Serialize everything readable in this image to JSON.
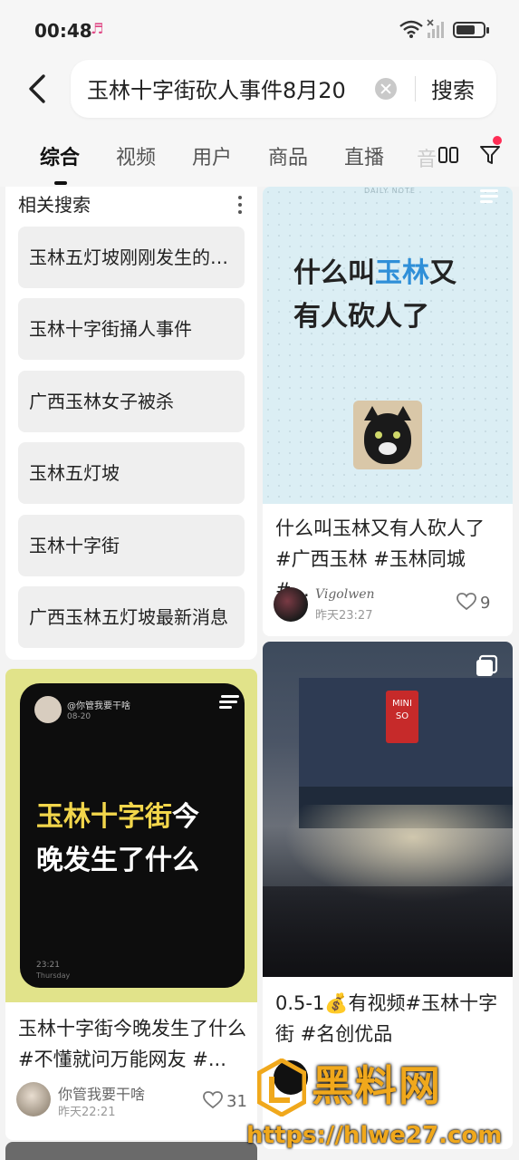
{
  "status_bar": {
    "time": "00:48",
    "music_icon": "music-note-icon",
    "battery_level": 0.7
  },
  "search": {
    "query": "玉林十字街砍人事件8月20",
    "search_button": "搜索",
    "back_icon": "chevron-left-icon",
    "clear_icon": "clear-circle-icon"
  },
  "tabs": {
    "items": [
      "综合",
      "视频",
      "用户",
      "商品",
      "直播",
      "音"
    ],
    "active_index": 0,
    "layout_icon": "double-column-icon",
    "filter_icon": "filter-icon",
    "filter_badge_color": "#ff2d55"
  },
  "related": {
    "title": "相关搜索",
    "items": [
      "玉林五灯坡刚刚发生的事情",
      "玉林十字街捅人事件",
      "广西玉林女子被杀",
      "玉林五灯坡",
      "玉林十字街",
      "广西玉林五灯坡最新消息"
    ]
  },
  "card_a": {
    "cover_header": "DAILY NOTE",
    "cover_line1_pre": "什么叫",
    "cover_line1_hl": "玉林",
    "cover_line1_post": "又",
    "cover_line2": "有人砍人了",
    "title": "什么叫玉林又有人砍人了 #广西玉林 #玉林同城 #...",
    "author": "Vigolwen",
    "time": "昨天23:27",
    "likes": "9"
  },
  "card_b": {
    "mini_user": "@你管我要干啥",
    "mini_date": "08-20",
    "cover_line1_hl": "玉林十字街",
    "cover_line1_post": "今",
    "cover_line2": "晚发生了什么",
    "mini_time": "23:21",
    "mini_day": "Thursday",
    "title": "玉林十字街今晚发生了什么#不懂就问万能网友 #...",
    "author": "你管我要干啥",
    "time": "昨天22:21",
    "likes": "31"
  },
  "card_c": {
    "sign_text": "MINI SO",
    "title": "0.5-1💰有视频#玉林十字街 #名创优品"
  },
  "watermark": {
    "brand": "黑料网",
    "url": "https://hlwe27.com"
  },
  "colors": {
    "accent_blue": "#2f8fd8",
    "accent_yellow": "#f2d64b",
    "watermark_gold": "#f0a81c"
  }
}
